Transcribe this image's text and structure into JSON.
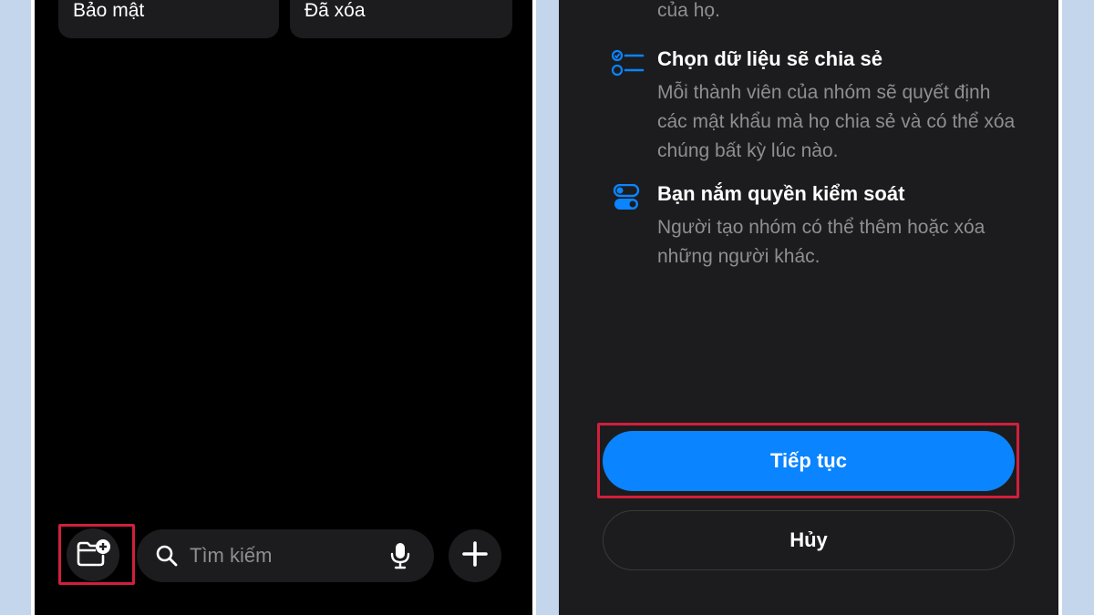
{
  "left_phone": {
    "cards": [
      {
        "label": "Bảo mật"
      },
      {
        "label": "Đã xóa"
      }
    ],
    "toolbar": {
      "new_group_icon": "folder-plus-icon",
      "search_placeholder": "Tìm kiếm",
      "search_icon": "search-icon",
      "mic_icon": "microphone-icon",
      "add_icon": "plus-icon"
    }
  },
  "right_phone": {
    "top_text": "của họ.",
    "features": [
      {
        "icon": "checklist-icon",
        "title": "Chọn dữ liệu sẽ chia sẻ",
        "description": "Mỗi thành viên của nhóm sẽ quyết định các mật khẩu mà họ chia sẻ và có thể xóa chúng bất kỳ lúc nào."
      },
      {
        "icon": "toggle-switches-icon",
        "title": "Bạn nắm quyền kiểm soát",
        "description": "Người tạo nhóm có thể thêm hoặc xóa những người khác."
      }
    ],
    "continue_label": "Tiếp tục",
    "cancel_label": "Hủy"
  },
  "colors": {
    "accent_blue": "#0a84ff",
    "highlight_red": "#d21f3c",
    "frame_background": "#c3d6ec"
  }
}
